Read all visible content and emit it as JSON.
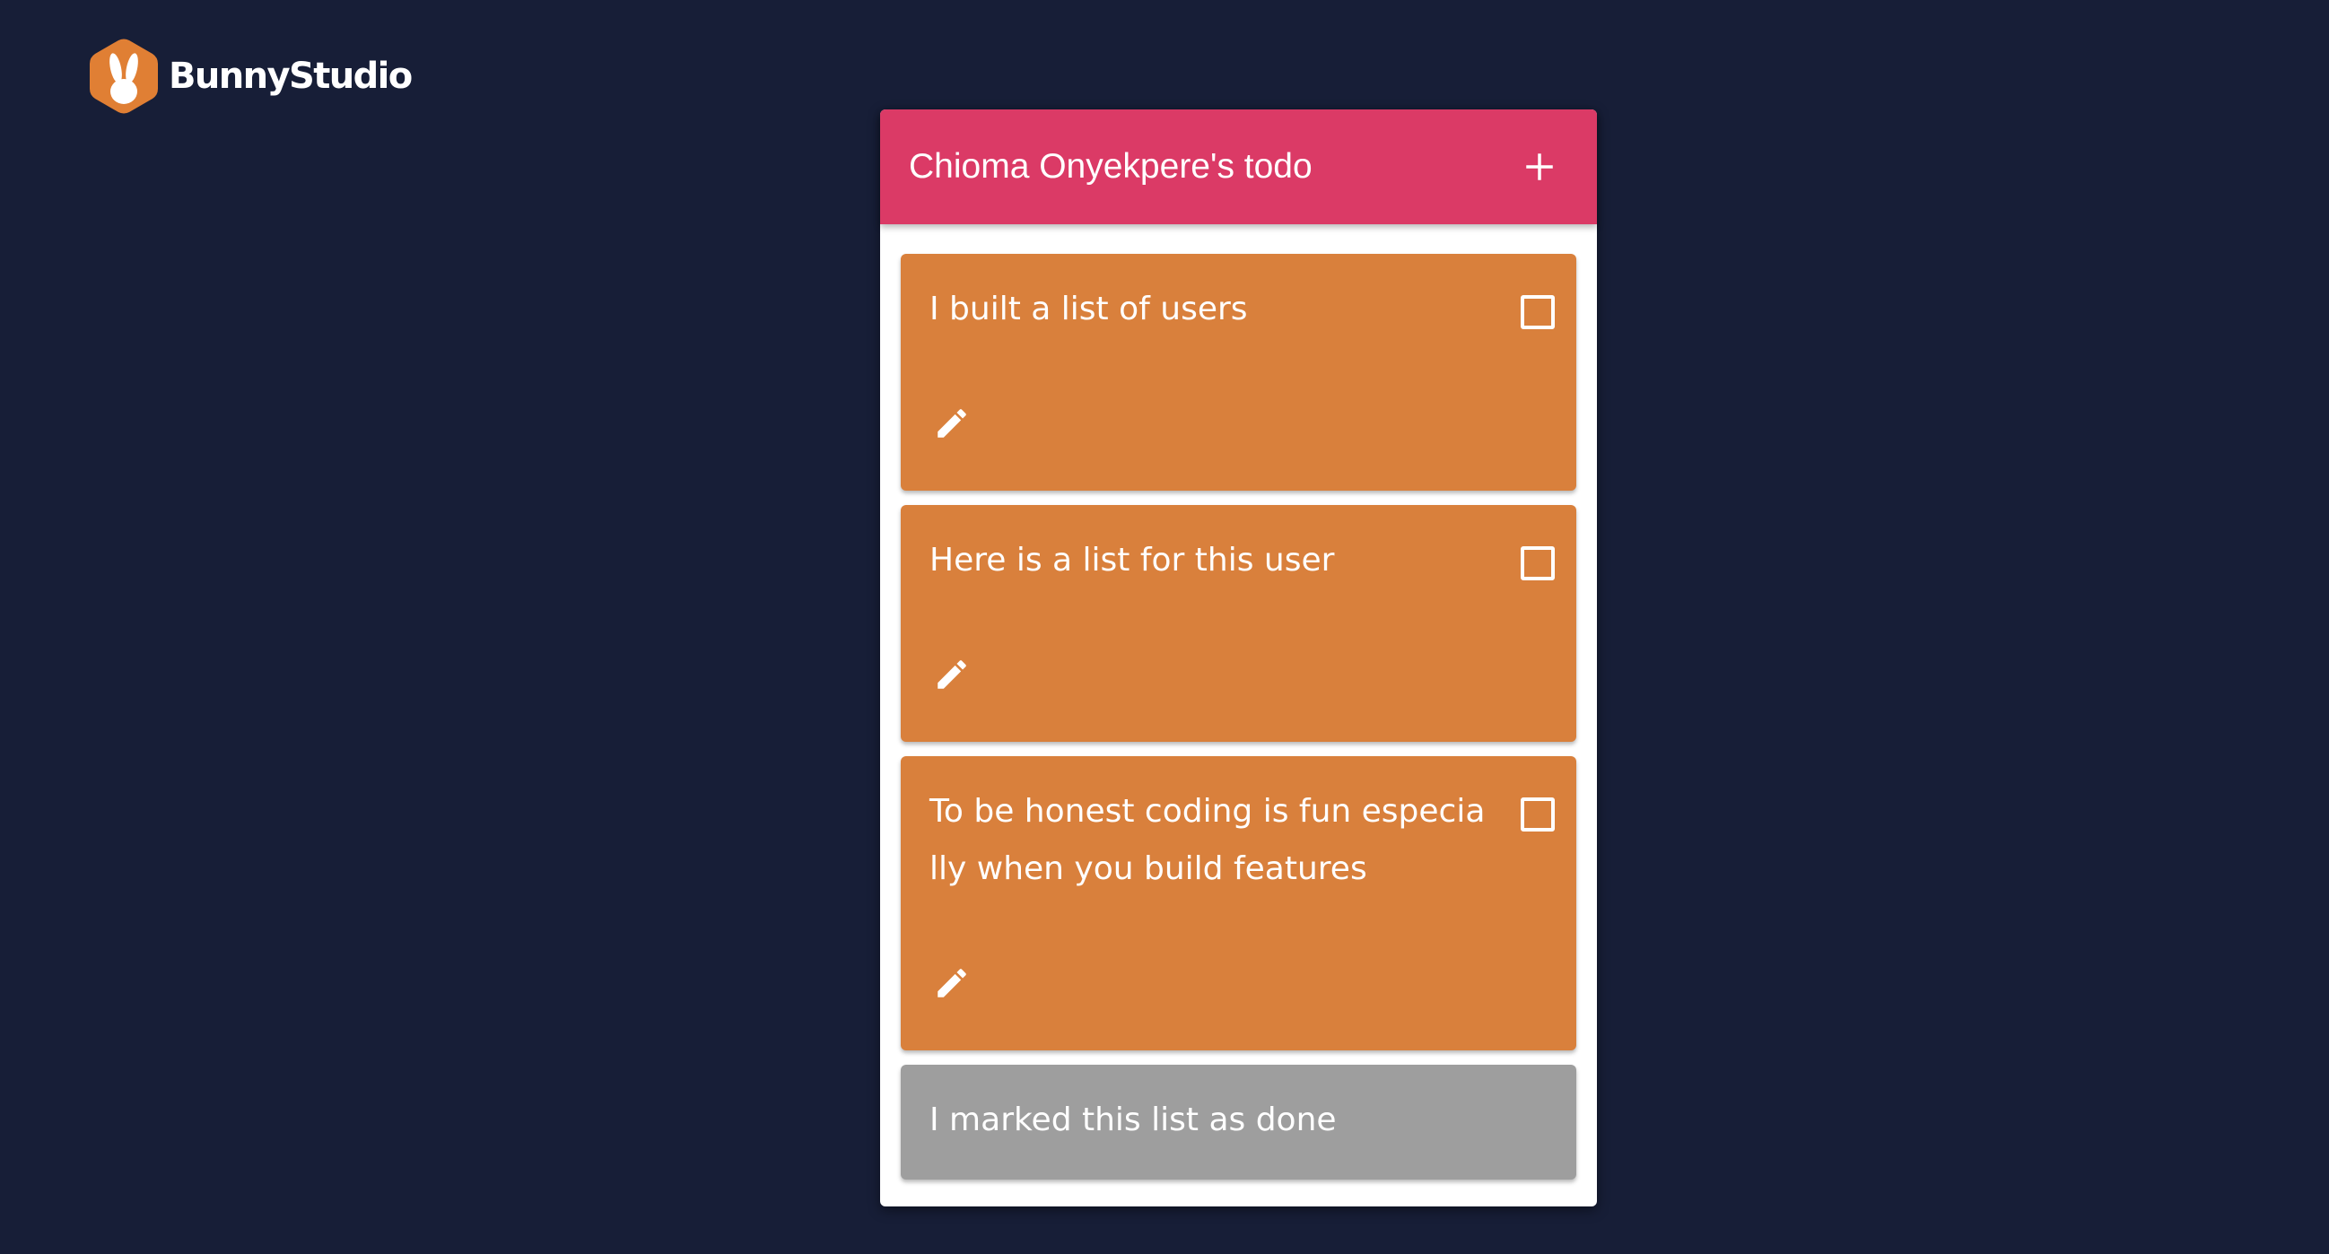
{
  "brand": {
    "name": "BunnyStudio",
    "logo_icon": "bunny-hexagon-logo",
    "logo_color": "#e07f34"
  },
  "todo": {
    "title": "Chioma Onyekpere's todo",
    "add_icon": "plus-icon",
    "header_color": "#db3a66",
    "items": [
      {
        "text": "I built a list of users",
        "done": false,
        "edit_icon": "pencil-icon"
      },
      {
        "text": "Here is a list for this user",
        "done": false,
        "edit_icon": "pencil-icon"
      },
      {
        "text": "To be honest coding is fun especially when you build features",
        "done": false,
        "edit_icon": "pencil-icon"
      },
      {
        "text": "I marked this list as done",
        "done": true
      }
    ]
  },
  "colors": {
    "background": "#171e37",
    "item_pending": "#d9803c",
    "item_done": "#9e9e9e"
  }
}
